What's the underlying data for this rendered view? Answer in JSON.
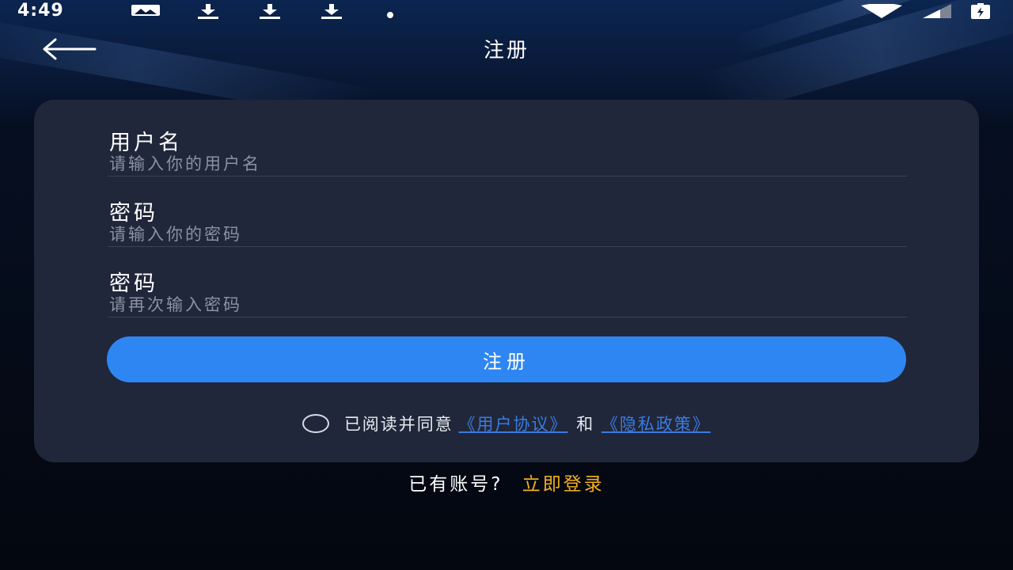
{
  "status_bar": {
    "time": "4:49",
    "icons": [
      "image-icon",
      "download-icon",
      "download-icon",
      "download-icon",
      "dot-icon",
      "wifi-icon",
      "signal-icon",
      "battery-icon"
    ]
  },
  "header": {
    "title": "注册",
    "back_icon": "arrow-left-icon"
  },
  "form": {
    "username_label": "用户名",
    "username_placeholder": "请输入你的用户名",
    "password_label": "密码",
    "password_placeholder": "请输入你的密码",
    "confirm_label": "密码",
    "confirm_placeholder": "请再次输入密码",
    "submit_label": "注册",
    "agree_text": "已阅读并同意",
    "user_agreement": "《用户协议》",
    "and_text": "和",
    "privacy_policy": "《隐私政策》"
  },
  "footer": {
    "prompt": "已有账号?",
    "login_link": "立即登录"
  },
  "colors": {
    "card_bg": "#20273a",
    "button_blue": "#2e86f2",
    "link_blue": "#3b7be0",
    "login_link": "#f2b01e"
  }
}
